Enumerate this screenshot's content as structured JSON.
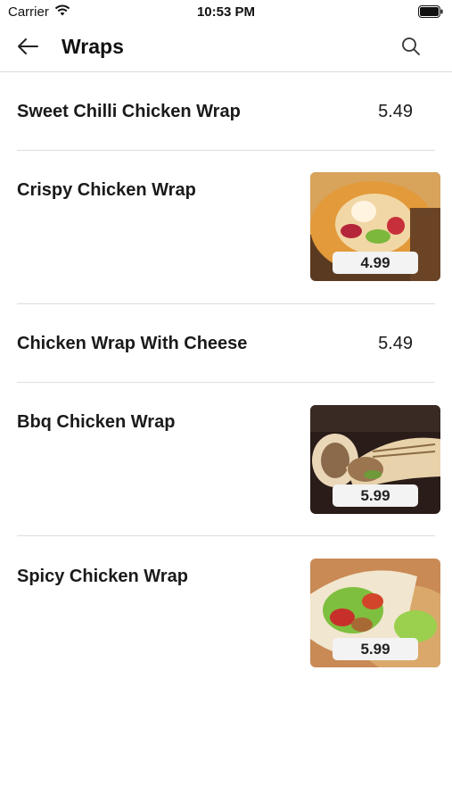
{
  "status_bar": {
    "carrier": "Carrier",
    "time": "10:53 PM"
  },
  "header": {
    "title": "Wraps",
    "back_icon": "arrow-left-icon",
    "search_icon": "search-icon"
  },
  "items": [
    {
      "name": "Sweet Chilli Chicken Wrap",
      "price": "5.49",
      "has_image": false
    },
    {
      "name": "Crispy Chicken Wrap",
      "price": "4.99",
      "has_image": true,
      "image": "crispy-chicken-wrap-photo"
    },
    {
      "name": "Chicken Wrap With Cheese",
      "price": "5.49",
      "has_image": false
    },
    {
      "name": "Bbq Chicken Wrap",
      "price": "5.99",
      "has_image": true,
      "image": "bbq-chicken-wrap-photo"
    },
    {
      "name": "Spicy Chicken Wrap",
      "price": "5.99",
      "has_image": true,
      "image": "spicy-chicken-wrap-photo"
    }
  ]
}
